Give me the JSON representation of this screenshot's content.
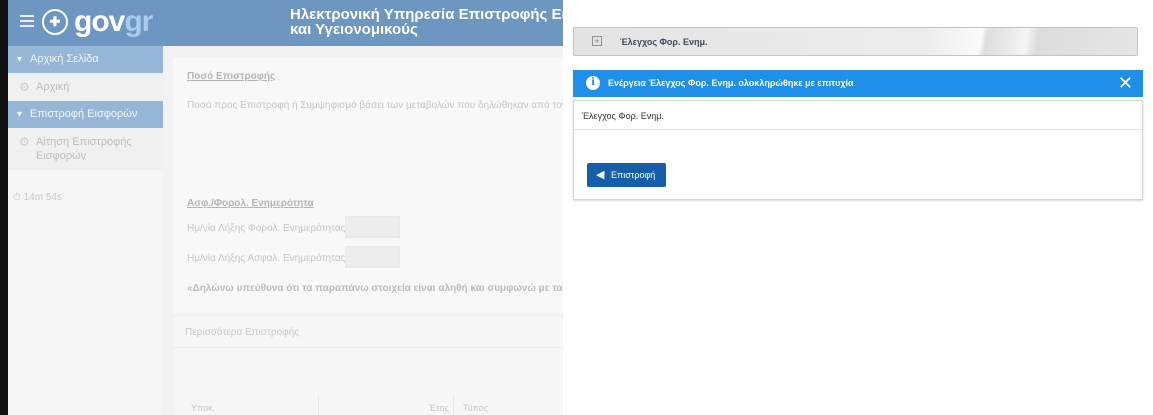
{
  "header": {
    "logo_text_gov": "gov",
    "logo_text_gr": "gr",
    "title_line1": "Ηλεκτρονική Υπηρεσία Επιστροφής Εισφορώ",
    "title_line2": "και Υγειονομικούς"
  },
  "sidebar": {
    "sections": [
      {
        "label": "Αρχική Σελίδα",
        "items": [
          {
            "label": "Αρχική"
          }
        ]
      },
      {
        "label": "Επιστροφή Εισφορών",
        "items": [
          {
            "label_line1": "Αίτηση Επιστροφής",
            "label_line2": "Εισφορών"
          }
        ]
      }
    ],
    "timer": "14m 54s"
  },
  "main": {
    "amount_title": "Ποσό Επιστροφής",
    "amount_text": "Ποσό προς Επιστροφή ή Συμψηφισμό βάσει των μεταβολών που δηλώθηκαν από τον εργοδότη σ",
    "currency_title": "Ασφ./Φορολ. Ενημερότητα",
    "tax_label": "Ημ/νία Λήξης Φορολ. Ενημερότητας:",
    "insurance_label": "Ημ/νία Λήξης Ασφαλ. Ενημερότητας:",
    "declaration": "«Δηλώνω υπεύθυνα ότι τα παραπάνω στοιχεία είναι αληθή και συμφωνώ με τα κατωτέρω π",
    "refunds_title": "Περισσότερα Επιστροφής",
    "table_headers": [
      "Υποκ.",
      "Έτος",
      "Τύπος"
    ]
  },
  "modal": {
    "accordion_label": "Έλεγχος Φορ. Ενημ.",
    "alert_text": "Ενέργεια Έλεγχος Φορ. Ενημ. ολοκληρώθηκε με επιτυχία",
    "alert_close": "✕",
    "panel_title": "Έλεγχος Φορ. Ενημ.",
    "back_button": "Επιστροφή"
  },
  "colors": {
    "brand": "#1f5fa0",
    "alert": "#1f8fea",
    "button": "#145fa8"
  }
}
